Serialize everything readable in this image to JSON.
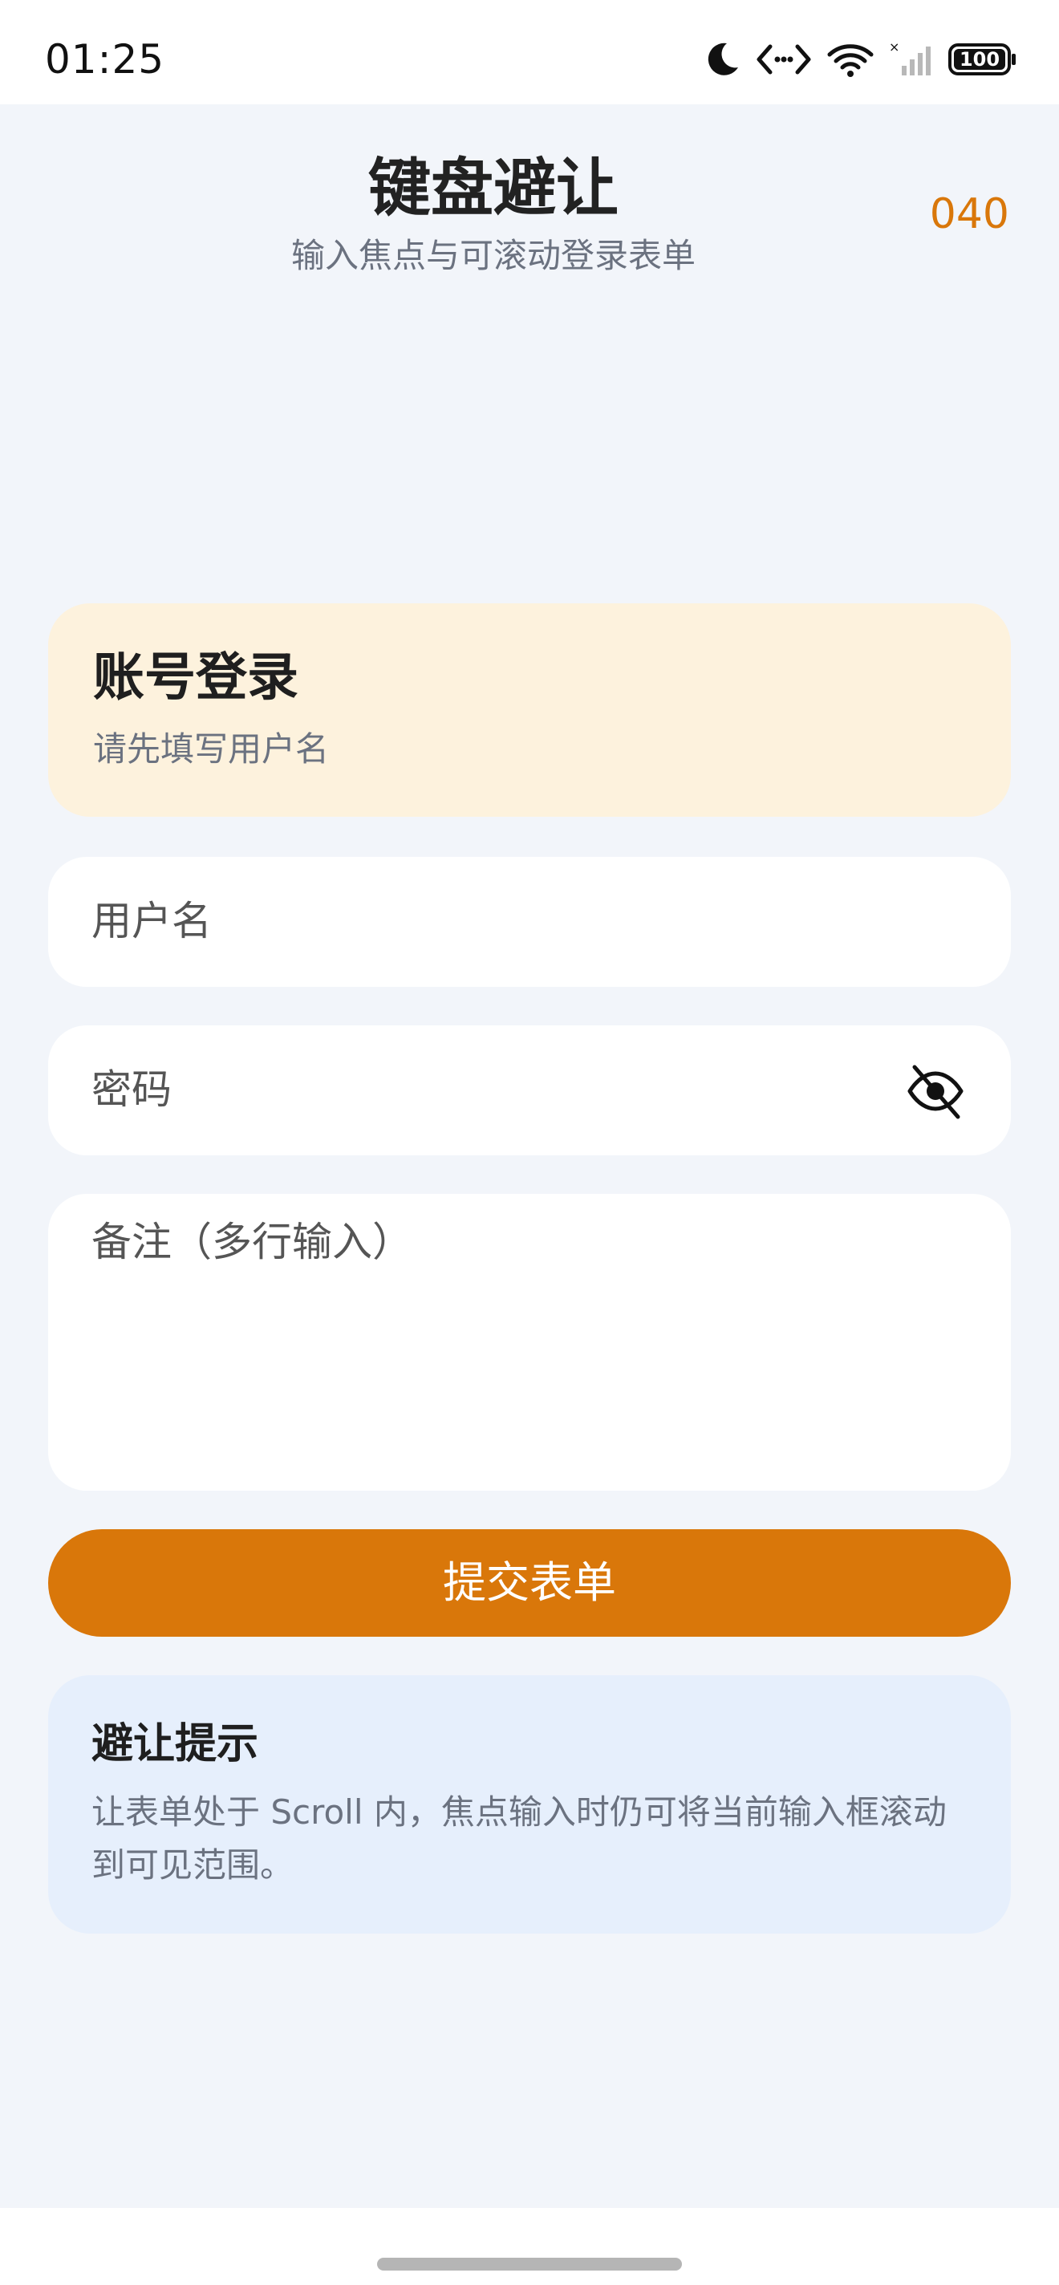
{
  "status_bar": {
    "time": "01:25",
    "battery": "100",
    "icons": [
      "moon-icon",
      "dev-code-icon",
      "wifi-icon",
      "signal-icon",
      "battery-icon"
    ]
  },
  "header": {
    "title": "键盘避让",
    "subtitle": "输入焦点与可滚动登录表单",
    "counter": "040"
  },
  "login_card": {
    "title": "账号登录",
    "hint": "请先填写用户名"
  },
  "form": {
    "username_placeholder": "用户名",
    "password_placeholder": "密码",
    "remark_placeholder": "备注（多行输入）",
    "password_toggle_icon": "eye-off-icon",
    "submit_label": "提交表单"
  },
  "tip_card": {
    "title": "避让提示",
    "body": "让表单处于 Scroll 内，焦点输入时仍可将当前输入框滚动到可见范围。"
  },
  "colors": {
    "accent": "#d9770a",
    "background": "#f2f5fa",
    "login_card_bg": "#fdf2dd",
    "tip_card_bg": "#e6effc"
  }
}
